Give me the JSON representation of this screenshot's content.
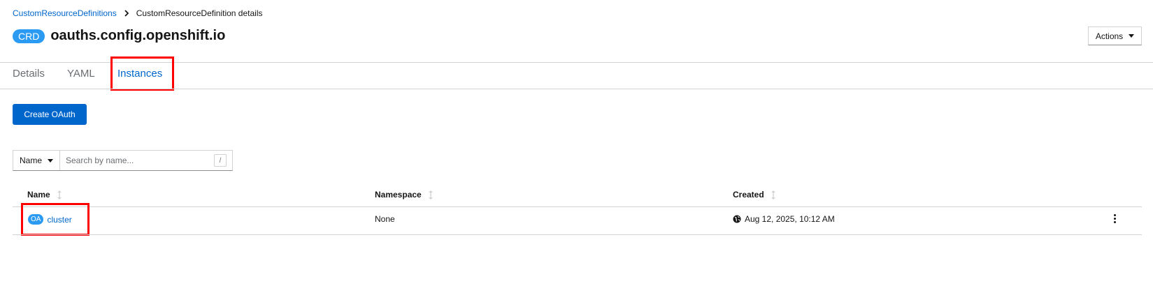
{
  "breadcrumb": {
    "parent": "CustomResourceDefinitions",
    "current": "CustomResourceDefinition details"
  },
  "header": {
    "badge": "CRD",
    "title": "oauths.config.openshift.io",
    "actions_label": "Actions"
  },
  "tabs": [
    {
      "label": "Details",
      "active": false
    },
    {
      "label": "YAML",
      "active": false
    },
    {
      "label": "Instances",
      "active": true
    }
  ],
  "toolbar": {
    "create_label": "Create OAuth"
  },
  "filter": {
    "select_value": "Name",
    "placeholder": "Search by name...",
    "shortcut": "/"
  },
  "table": {
    "columns": [
      "Name",
      "Namespace",
      "Created"
    ],
    "rows": [
      {
        "badge": "OA",
        "name": "cluster",
        "namespace": "None",
        "created": "Aug 12, 2025, 10:12 AM"
      }
    ]
  },
  "colors": {
    "link": "#0066cc",
    "primary_button": "#0066cc",
    "badge": "#2b9af3",
    "highlight": "#ff0000"
  },
  "icons": [
    "chevron-right-icon",
    "caret-down-icon",
    "sort-icon",
    "globe-icon",
    "kebab-icon"
  ]
}
